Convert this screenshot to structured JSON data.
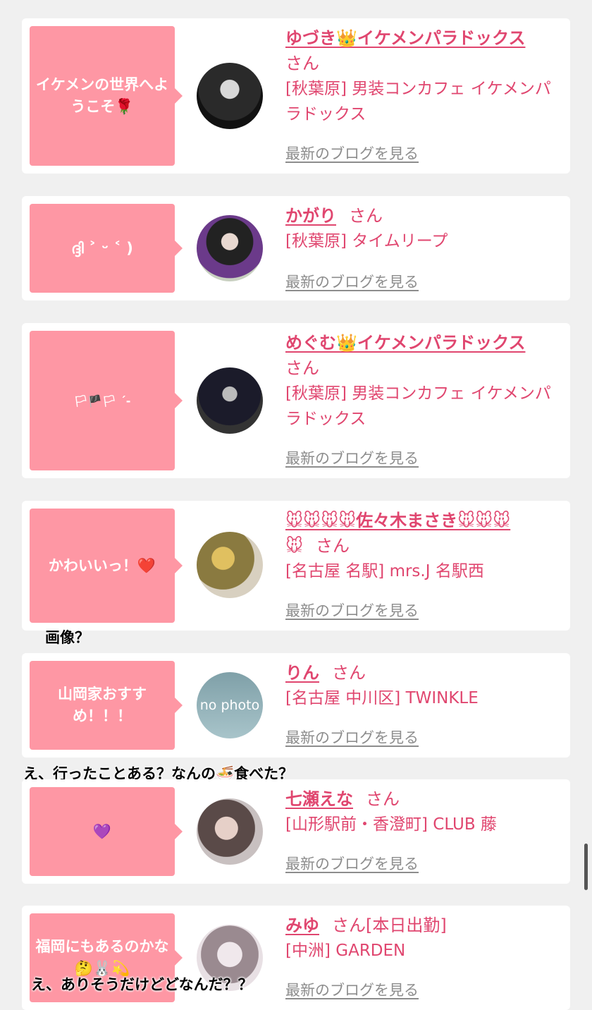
{
  "cards": [
    {
      "bubble": "イケメンの世界へようこそ🌹",
      "name": "ゆづき👑イケメンパラドックス",
      "san": "さん",
      "desc": "[秋葉原] 男装コンカフェ イケメンパラドックス",
      "blog": "最新のブログを見る"
    },
    {
      "bubble": "ദ്ദി ˃ ᵕ ˂ )",
      "name": "かがり",
      "san": "さん",
      "desc": "[秋葉原] タイムリープ",
      "blog": "最新のブログを見る"
    },
    {
      "bubble": "🏳🏴🏳 ˊ-",
      "name": "めぐむ👑イケメンパラドックス",
      "san": "さん",
      "desc": "[秋葉原] 男装コンカフェ イケメンパラドックス",
      "blog": "最新のブログを見る"
    },
    {
      "bubble": "かわいいっ！❤️",
      "name": "🐭🐭🐭🐭佐々木まさき🐭🐭🐭",
      "san": "さん",
      "desc": "[名古屋 名駅] mrs.J 名駅西",
      "blog": "最新のブログを見る"
    },
    {
      "bubble": "山岡家おすすめ！！！",
      "name": "りん",
      "san": "さん",
      "desc": "[名古屋 中川区] TWINKLE",
      "blog": "最新のブログを見る",
      "nophoto": "no photo"
    },
    {
      "bubble": "💜",
      "name": "七瀬えな",
      "san": "さん",
      "desc": "[山形駅前・香澄町] CLUB 藤",
      "blog": "最新のブログを見る"
    },
    {
      "bubble": "福岡にもあるのかな🤔🐰💫",
      "name": "みゆ",
      "san": "さん[本日出勤]",
      "desc": "[中洲] GARDEN",
      "blog": "最新のブログを見る"
    }
  ],
  "captions": {
    "c1": "画像？",
    "c2": "え、行ったことある？なんの🍜食べた？",
    "c3": "え、ありそうだけどどなんだ？？"
  },
  "colors": {
    "accent": "#e0466f",
    "bubble": "#fe97a4",
    "background": "#f0f0f0"
  }
}
